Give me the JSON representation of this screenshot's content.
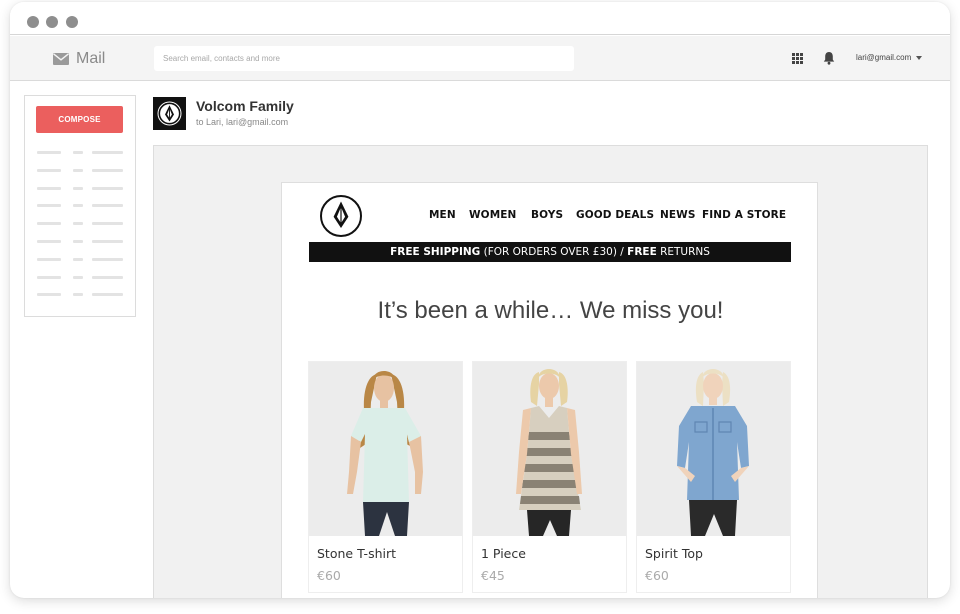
{
  "window": {
    "controls": [
      "close",
      "minimize",
      "maximize"
    ]
  },
  "app": {
    "name": "Mail",
    "icon": "envelope-icon"
  },
  "search": {
    "placeholder": "Search email, contacts and more"
  },
  "toolbar": {
    "icons": [
      "apps-grid-icon",
      "bell-icon"
    ],
    "account": "lari@gmail.com"
  },
  "sidebar": {
    "compose_label": "COMPOSE"
  },
  "message": {
    "sender": "Volcom Family",
    "recipients": "to Lari, lari@gmail.com"
  },
  "email": {
    "nav": [
      "MEN",
      "WOMEN",
      "BOYS",
      "GOOD DEALS",
      "NEWS",
      "FIND A STORE"
    ],
    "banner": {
      "part1": "FREE SHIPPING",
      "part2": " (FOR ORDERS OVER £30) / ",
      "part3": "FREE",
      "part4": " RETURNS"
    },
    "headline": "It’s been a while… We miss you!",
    "products": [
      {
        "name": "Stone T-shirt",
        "price": "€60"
      },
      {
        "name": "1 Piece",
        "price": "€45"
      },
      {
        "name": "Spirit Top",
        "price": "€60"
      }
    ]
  },
  "colors": {
    "compose": "#eb5f5e",
    "banner": "#111111",
    "frame": "#f1f1f1"
  }
}
